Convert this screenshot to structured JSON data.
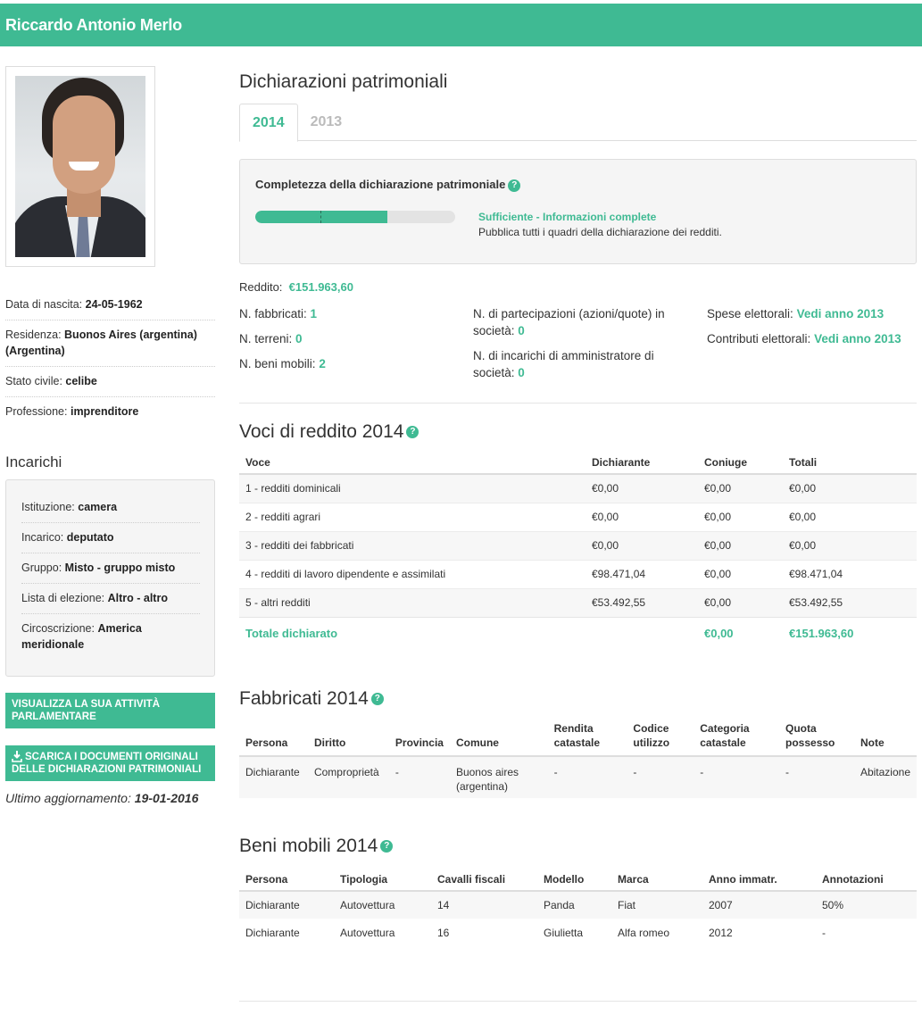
{
  "header": {
    "name": "Riccardo Antonio Merlo"
  },
  "colors": {
    "accent": "#3fba93",
    "box_bg": "#f5f5f5"
  },
  "bio": {
    "birth_label": "Data di nascita:",
    "birth_value": "24-05-1962",
    "residence_label": "Residenza:",
    "residence_value": "Buonos Aires (argentina) (Argentina)",
    "civil_label": "Stato civile:",
    "civil_value": "celibe",
    "job_label": "Professione:",
    "job_value": "imprenditore"
  },
  "incarichi": {
    "title": "Incarichi",
    "istituzione_label": "Istituzione:",
    "istituzione_value": "camera",
    "incarico_label": "Incarico:",
    "incarico_value": "deputato",
    "gruppo_label": "Gruppo:",
    "gruppo_value": "Misto - gruppo misto",
    "lista_label": "Lista di elezione:",
    "lista_value": "Altro - altro",
    "circ_label": "Circoscrizione:",
    "circ_value": "America meridionale"
  },
  "buttons": {
    "attivita": "VISUALIZZA LA SUA ATTIVITÀ PARLAMENTARE",
    "scarica": "SCARICA I DOCUMENTI ORIGINALI DELLE DICHIARAZIONI PATRIMONIALI",
    "download_icon": "download-icon"
  },
  "updated": {
    "label": "Ultimo aggiornamento:",
    "value": "19-01-2016"
  },
  "main": {
    "title": "Dichiarazioni patrimoniali",
    "tabs": [
      {
        "label": "2014",
        "active": true
      },
      {
        "label": "2013",
        "active": false
      }
    ],
    "completeness": {
      "title": "Completezza della dichiarazione patrimoniale",
      "help": "?",
      "progress": 0.66,
      "status": "Sufficiente - Informazioni complete",
      "description": "Pubblica tutti i quadri della dichiarazione dei redditi."
    },
    "stats": {
      "reddito_label": "Reddito:",
      "reddito_value": "€151.963,60",
      "fabbricati_label": "N. fabbricati:",
      "fabbricati_value": "1",
      "terreni_label": "N. terreni:",
      "terreni_value": "0",
      "beni_label": "N. beni mobili:",
      "beni_value": "2",
      "partecipazioni_label": "N. di partecipazioni (azioni/quote) in società:",
      "partecipazioni_value": "0",
      "incarichi_label": "N. di incarichi di amministratore di società:",
      "incarichi_value": "0",
      "spese_label": "Spese elettorali:",
      "spese_value": "Vedi anno 2013",
      "contributi_label": "Contributi elettorali:",
      "contributi_value": "Vedi anno 2013"
    }
  },
  "voci": {
    "title": "Voci di reddito 2014",
    "headers": [
      "Voce",
      "Dichiarante",
      "Coniuge",
      "Totali"
    ],
    "rows": [
      [
        "1 - redditi dominicali",
        "€0,00",
        "€0,00",
        "€0,00"
      ],
      [
        "2 - redditi agrari",
        "€0,00",
        "€0,00",
        "€0,00"
      ],
      [
        "3 - redditi dei fabbricati",
        "€0,00",
        "€0,00",
        "€0,00"
      ],
      [
        "4 - redditi di lavoro dipendente e assimilati",
        "€98.471,04",
        "€0,00",
        "€98.471,04"
      ],
      [
        "5 - altri redditi",
        "€53.492,55",
        "€0,00",
        "€53.492,55"
      ]
    ],
    "total": {
      "label": "Totale dichiarato",
      "coniuge": "€0,00",
      "totali": "€151.963,60"
    }
  },
  "fabbricati": {
    "title": "Fabbricati 2014",
    "headers": [
      "Persona",
      "Diritto",
      "Provincia",
      "Comune",
      "Rendita catastale",
      "Codice utilizzo",
      "Categoria catastale",
      "Quota possesso",
      "Note"
    ],
    "rows": [
      [
        "Dichiarante",
        "Comproprietà",
        "-",
        "Buonos aires (argentina)",
        "-",
        "-",
        "-",
        "-",
        "Abitazione"
      ]
    ]
  },
  "beni": {
    "title": "Beni mobili 2014",
    "headers": [
      "Persona",
      "Tipologia",
      "Cavalli fiscali",
      "Modello",
      "Marca",
      "Anno immatr.",
      "Annotazioni"
    ],
    "rows": [
      [
        "Dichiarante",
        "Autovettura",
        "14",
        "Panda",
        "Fiat",
        "2007",
        "50%"
      ],
      [
        "Dichiarante",
        "Autovettura",
        "16",
        "Giulietta",
        "Alfa romeo",
        "2012",
        "-"
      ]
    ]
  }
}
